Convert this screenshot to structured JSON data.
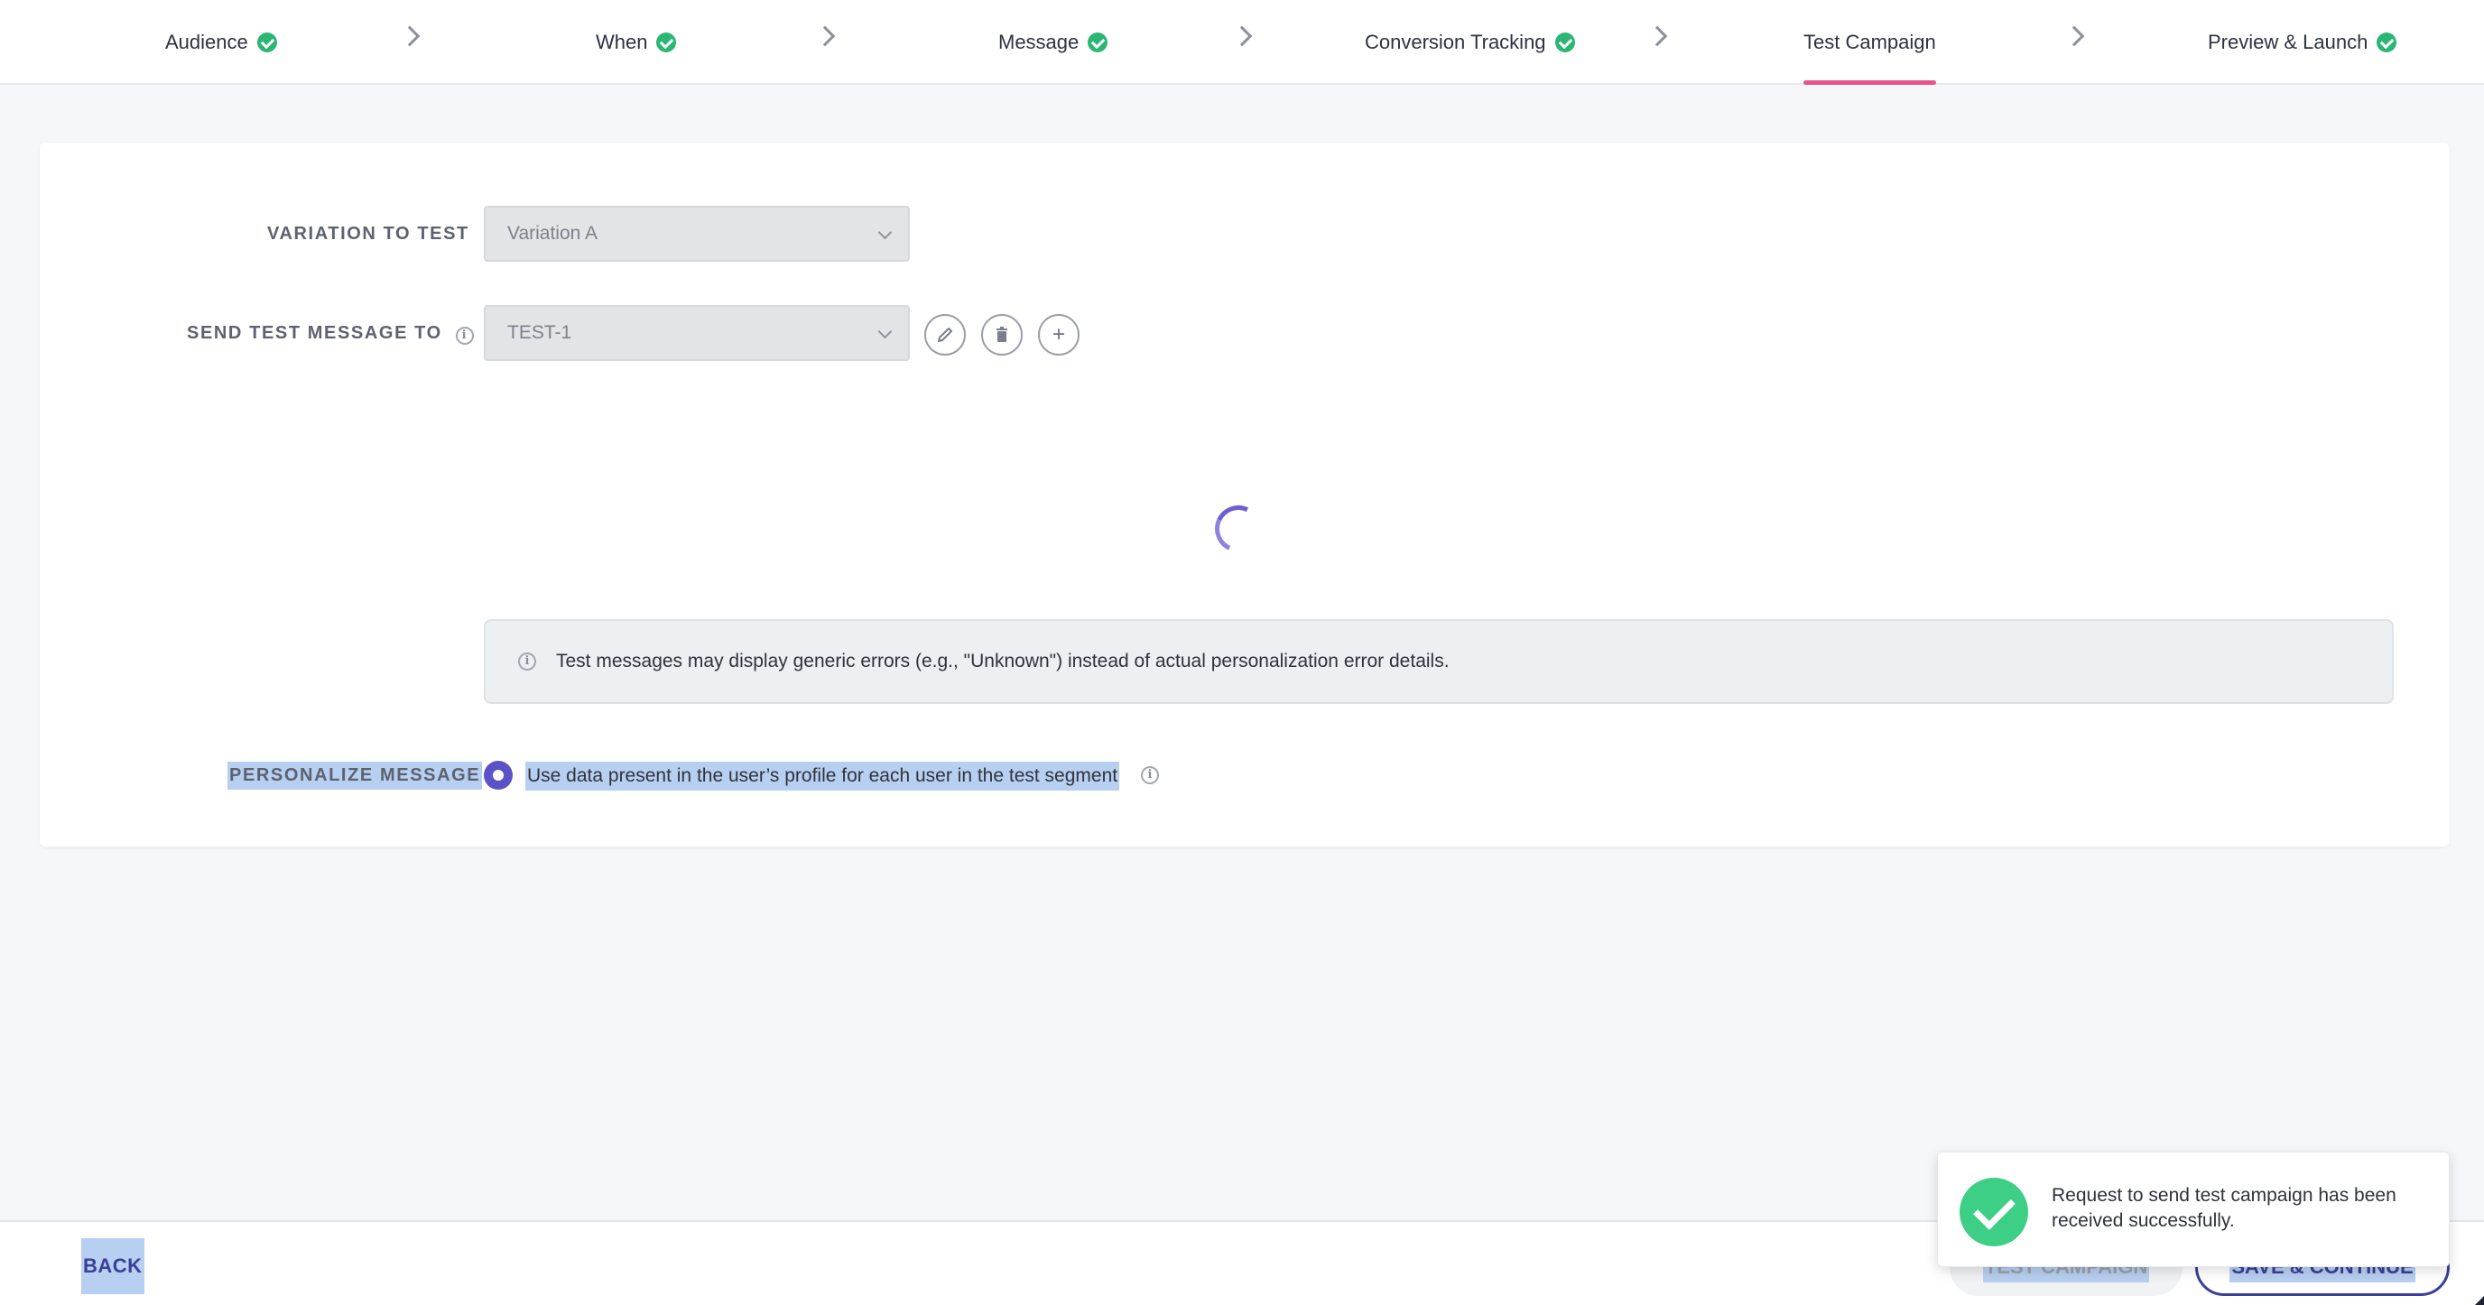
{
  "stepper": {
    "steps": [
      {
        "label": "Audience",
        "complete": true
      },
      {
        "label": "When",
        "complete": true
      },
      {
        "label": "Message",
        "complete": true
      },
      {
        "label": "Conversion Tracking",
        "complete": true
      },
      {
        "label": "Test Campaign",
        "complete": false,
        "active": true
      },
      {
        "label": "Preview & Launch",
        "complete": true
      }
    ]
  },
  "form": {
    "variation_label": "VARIATION TO TEST",
    "variation_value": "Variation A",
    "send_label": "SEND TEST MESSAGE TO",
    "send_value": "TEST-1",
    "edit_icon": "pencil-icon",
    "delete_icon": "trash-icon",
    "add_icon": "plus-icon",
    "plus_glyph": "+"
  },
  "notice": {
    "text": "Test messages may display generic errors (e.g., \"Unknown\") instead of actual personalization error details."
  },
  "personalize": {
    "label": "PERSONALIZE MESSAGE",
    "option_text": "Use data present in the user’s profile for each user in the test segment",
    "selected": true
  },
  "footer": {
    "back_label": "BACK",
    "test_label": "TEST CAMPAIGN",
    "save_label": "SAVE & CONTINUE"
  },
  "toast": {
    "message": "Request to send test campaign has been received successfully."
  },
  "colors": {
    "accent": "#e8548d",
    "primary": "#3a3f99",
    "success": "#2bb673",
    "radio": "#5b52c7"
  }
}
